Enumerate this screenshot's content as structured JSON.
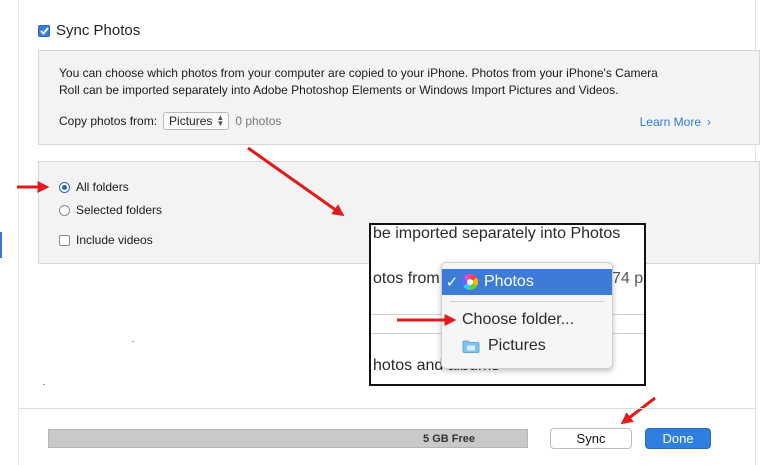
{
  "sync": {
    "title": "Sync Photos",
    "checked": true
  },
  "info": {
    "line1": "You can choose which photos from your computer are copied to your iPhone. Photos from your iPhone's Camera",
    "line2": "Roll can be imported separately into Adobe Photoshop Elements or Windows Import Pictures and Videos.",
    "copy_label": "Copy photos from:",
    "select_value": "Pictures",
    "photo_count": "0 photos",
    "learn_more": "Learn More"
  },
  "folders": {
    "all_folders": "All folders",
    "selected_folders": "Selected folders",
    "include_videos": "Include videos",
    "selected_option": "All folders",
    "include_videos_checked": false
  },
  "zoom": {
    "text_top": "be imported separately into Photos",
    "text_left": "otos from",
    "text_right": "74 p",
    "text_bottom": "hotos and albums",
    "menu": {
      "items": [
        {
          "label": "Photos",
          "checked": true,
          "icon": "photos-app-icon"
        },
        {
          "label": "Choose folder...",
          "checked": false
        },
        {
          "label": "Pictures",
          "checked": false,
          "icon": "folder-icon"
        }
      ]
    }
  },
  "footer": {
    "capacity_label": "5 GB Free",
    "sync_button": "Sync",
    "done_button": "Done"
  },
  "colors": {
    "accent": "#2f7fe1",
    "arrow": "#e01b1b",
    "panel_bg": "#f3f3f3",
    "link": "#2e7bd6"
  }
}
